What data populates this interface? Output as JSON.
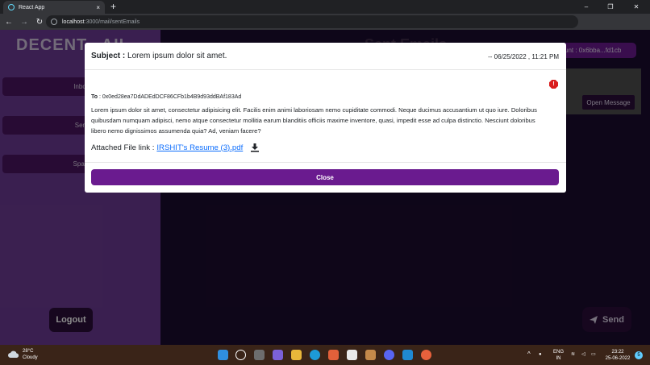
{
  "browser": {
    "tab_title": "React App",
    "tab_close": "×",
    "new_tab": "+",
    "url_host": "localhost",
    "url_path": ":3000/mail/sentEmails",
    "window_controls": [
      "–",
      "❐",
      "✕"
    ]
  },
  "app": {
    "brand": "DECENT...AIL",
    "page_heading": "Sent Emails",
    "account": "unt : 0x6bba...fd1cb",
    "sidebar": {
      "items": [
        "Inbox",
        "Sent",
        "Spam"
      ],
      "logout": "Logout"
    },
    "open_message": "Open Message",
    "send": "Send"
  },
  "modal": {
    "subject_label": "Subject :",
    "subject": "Lorem ipsum dolor sit amet.",
    "datetime": "-- 06/25/2022 , 11:21 PM",
    "alert": "!",
    "to_label": "To",
    "to_address": " : 0x0ed28ea7DdADEdDCF86CFb1b4B9d93ddBAf183Ad",
    "body": "Lorem ipsum dolor sit amet, consectetur adipisicing elit. Facilis enim animi laboriosam nemo cupiditate commodi. Neque ducimus accusantium ut quo iure. Doloribus quibusdam numquam adipisci, nemo atque consectetur mollitia earum blanditiis officiis maxime inventore, quasi, impedit esse ad culpa distinctio. Nesciunt doloribus libero nemo dignissimos assumenda quia? Ad, veniam facere?",
    "attach_label": "Attached File link :",
    "attach_file": "IRSHIT's Resume (3).pdf",
    "close": "Close"
  },
  "taskbar": {
    "weather_temp": "28°C",
    "weather_desc": "Cloudy",
    "lang_line1": "ENG",
    "lang_line2": "IN",
    "time": "23:22",
    "date": "25-06-2022",
    "notification_count": "5"
  },
  "colors": {
    "accent_purple": "#6a1b8f",
    "sidebar_purple": "#6b3a92",
    "link_blue": "#0d6efd",
    "alert_red": "#d91c1c"
  }
}
